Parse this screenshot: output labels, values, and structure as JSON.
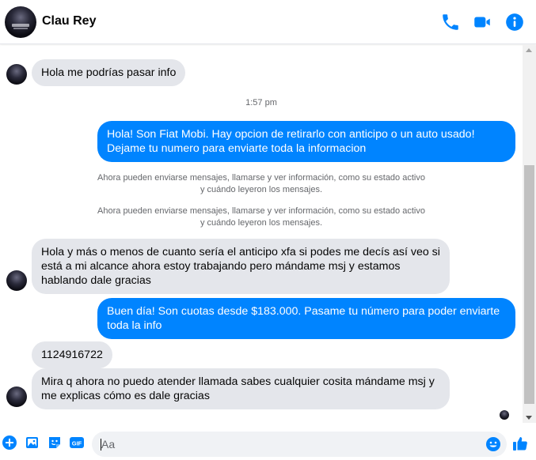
{
  "header": {
    "contact_name": "Clau Rey",
    "icons": [
      "phone-icon",
      "video-icon",
      "info-icon"
    ],
    "accent_color": "#0084ff"
  },
  "messages": {
    "m1": "Hola me podrías pasar info",
    "time1": "1:57 pm",
    "m2": "Hola! Son Fiat Mobi. Hay opcion de retirarlo con anticipo o un auto usado! Dejame tu numero para enviarte toda la informacion",
    "notice1_line1": "Ahora pueden enviarse mensajes, llamarse y ver información, como su estado activo",
    "notice1_line2": "y cuándo leyeron los mensajes.",
    "notice2_line1": "Ahora pueden enviarse mensajes, llamarse y ver información, como su estado activo",
    "notice2_line2": "y cuándo leyeron los mensajes.",
    "m3": "Hola y más o menos de cuanto sería el anticipo xfa si podes me decís así veo si está a mi alcance ahora estoy trabajando pero mándame msj y estamos hablando dale gracias",
    "m4": "Buen día! Son cuotas desde $183.000. Pasame tu número para poder enviarte toda la info",
    "m5": "1124916722",
    "m6": "Mira q ahora no puedo atender llamada sabes cualquier cosita mándame msj y me explicas cómo es dale gracias"
  },
  "composer": {
    "placeholder": "Aa",
    "icons": [
      "plus-icon",
      "photo-icon",
      "sticker-icon",
      "gif-icon",
      "emoji-icon",
      "thumbs-up-icon"
    ],
    "gif_label": "GIF"
  }
}
